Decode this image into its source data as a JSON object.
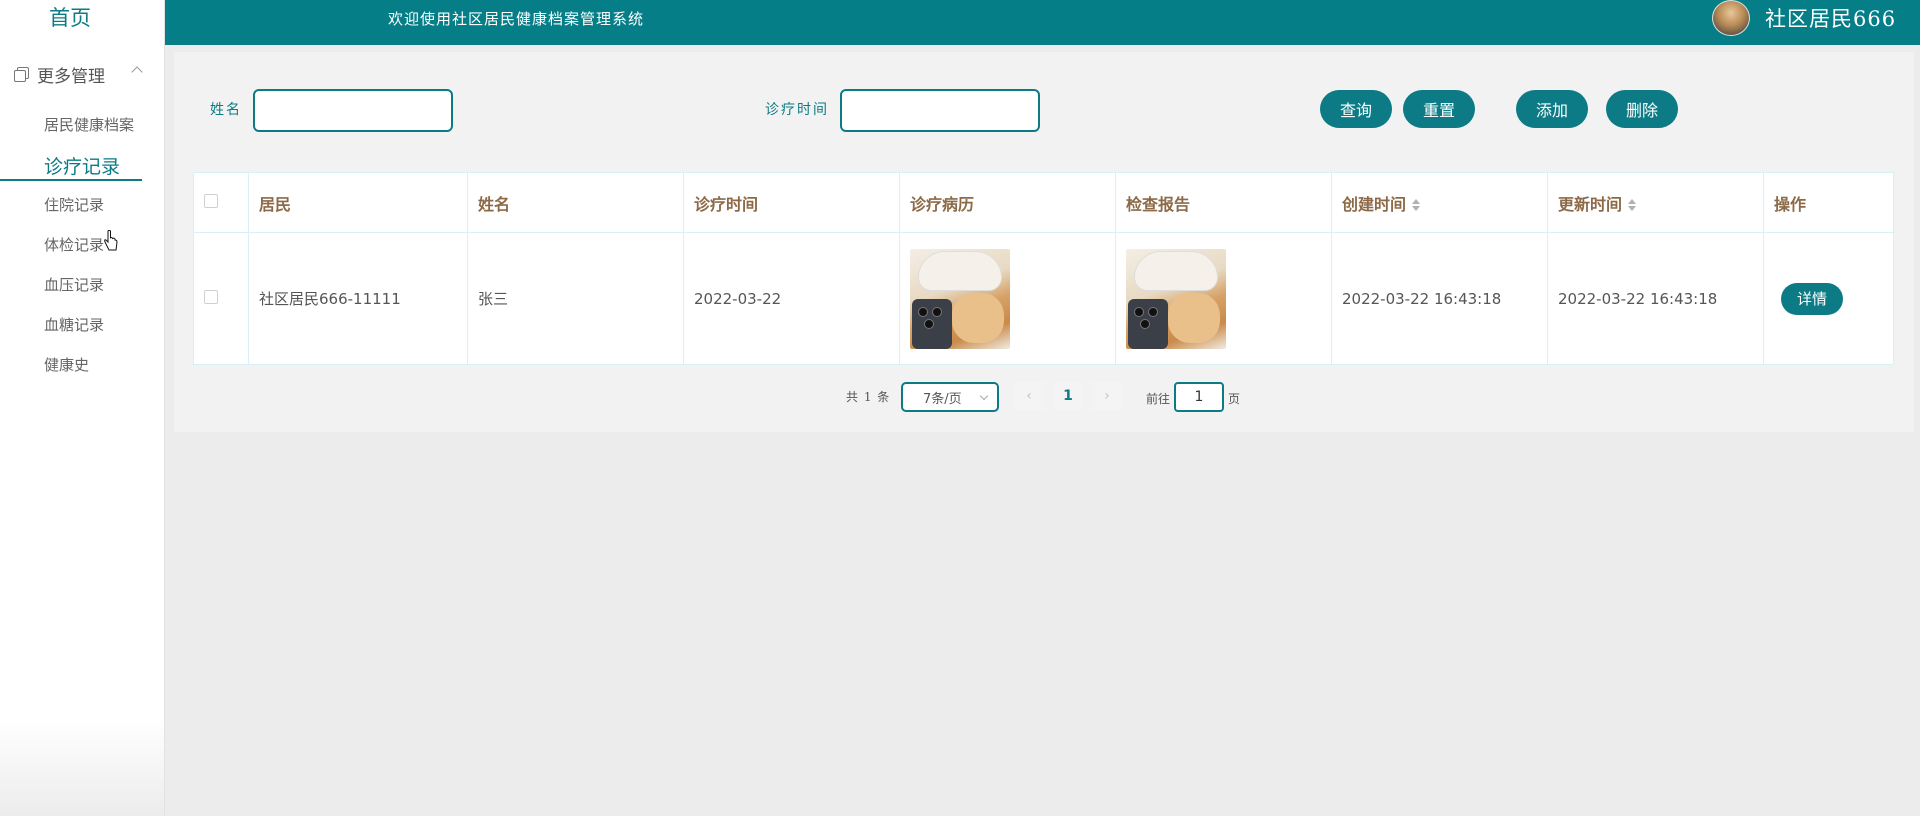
{
  "sidebar": {
    "home": "首页",
    "group": "更多管理",
    "items": [
      {
        "label": "居民健康档案"
      },
      {
        "label": "诊疗记录"
      },
      {
        "label": "住院记录"
      },
      {
        "label": "体检记录"
      },
      {
        "label": "血压记录"
      },
      {
        "label": "血糖记录"
      },
      {
        "label": "健康史"
      }
    ],
    "active_index": 1
  },
  "topbar": {
    "welcome": "欢迎使用社区居民健康档案管理系统",
    "username": "社区居民666"
  },
  "search": {
    "name_label": "姓名",
    "name_value": "",
    "time_label": "诊疗时间",
    "time_value": ""
  },
  "buttons": {
    "query": "查询",
    "reset": "重置",
    "add": "添加",
    "delete": "删除"
  },
  "table": {
    "headers": [
      "居民",
      "姓名",
      "诊疗时间",
      "诊疗病历",
      "检查报告",
      "创建时间",
      "更新时间",
      "操作"
    ],
    "rows": [
      {
        "resident": "社区居民666-11111",
        "name": "张三",
        "visit_time": "2022-03-22",
        "created": "2022-03-22 16:43:18",
        "updated": "2022-03-22 16:43:18",
        "action": "详情"
      }
    ]
  },
  "pagination": {
    "total": "共 1 条",
    "page_size": "7条/页",
    "prev": "‹",
    "current": "1",
    "next": "›",
    "goto_label": "前往",
    "goto_value": "1",
    "page_suffix": "页"
  },
  "colors": {
    "primary": "#0c7b85",
    "topbar": "#057e87",
    "header_text": "#8c6a48"
  }
}
